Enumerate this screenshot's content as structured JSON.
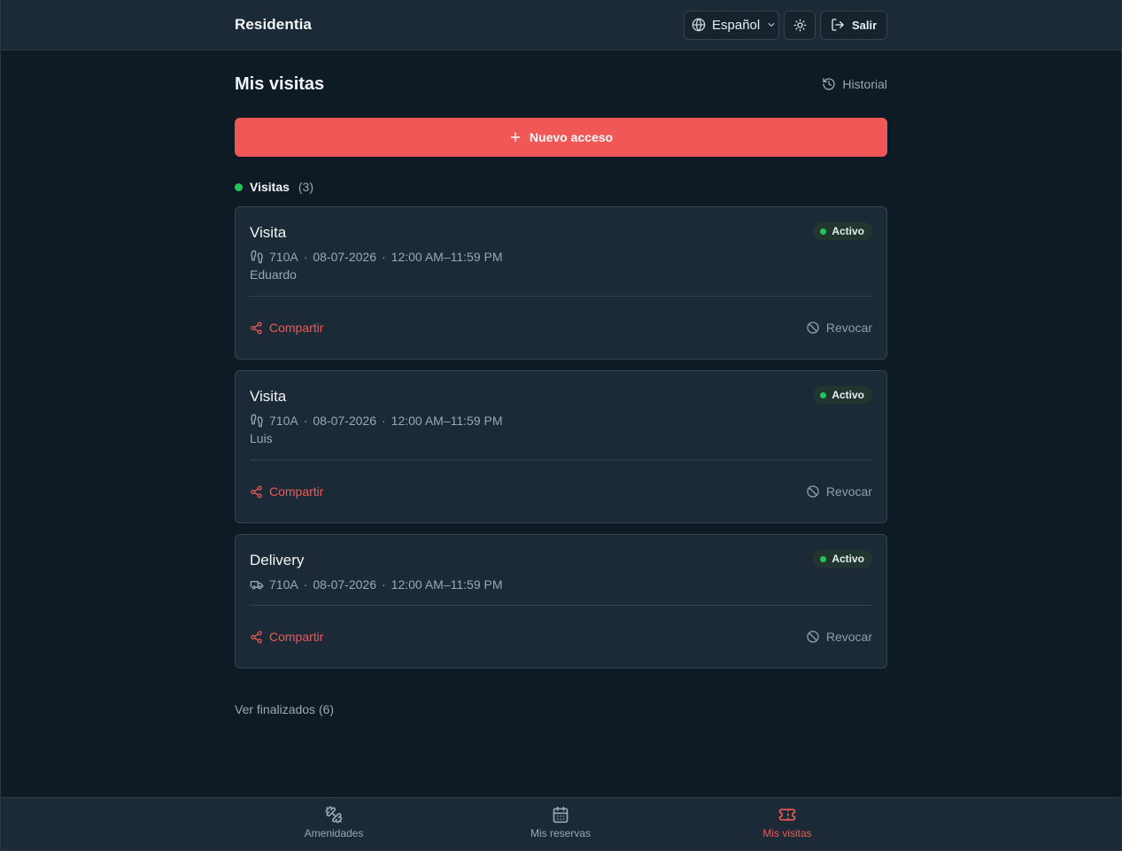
{
  "header": {
    "brand": "Residentia",
    "language": "Español",
    "logout_label": "Salir"
  },
  "main": {
    "title": "Mis visitas",
    "history_label": "Historial",
    "new_access_label": "Nuevo acceso",
    "section": {
      "label": "Visitas",
      "count": "(3)"
    },
    "cards": [
      {
        "type": "Visita",
        "status": "Activo",
        "unit": "710A",
        "date": "08-07-2026",
        "time": "12:00 AM–11:59 PM",
        "guest": "Eduardo",
        "share_label": "Compartir",
        "revoke_label": "Revocar",
        "icon": "footprints-icon"
      },
      {
        "type": "Visita",
        "status": "Activo",
        "unit": "710A",
        "date": "08-07-2026",
        "time": "12:00 AM–11:59 PM",
        "guest": "Luis",
        "share_label": "Compartir",
        "revoke_label": "Revocar",
        "icon": "footprints-icon"
      },
      {
        "type": "Delivery",
        "status": "Activo",
        "unit": "710A",
        "date": "08-07-2026",
        "time": "12:00 AM–11:59 PM",
        "share_label": "Compartir",
        "revoke_label": "Revocar",
        "icon": "truck-icon"
      }
    ],
    "finished_label": "Ver finalizados (6)"
  },
  "bottom_nav": {
    "items": [
      {
        "label": "Amenidades",
        "icon": "dumbbell-icon"
      },
      {
        "label": "Mis reservas",
        "icon": "calendar-icon"
      },
      {
        "label": "Mis visitas",
        "icon": "ticket-icon",
        "active": true
      }
    ]
  },
  "colors": {
    "accent": "#f25757",
    "status_active": "#22c55e",
    "background": "#0f1b24",
    "surface": "#1b2a36"
  }
}
